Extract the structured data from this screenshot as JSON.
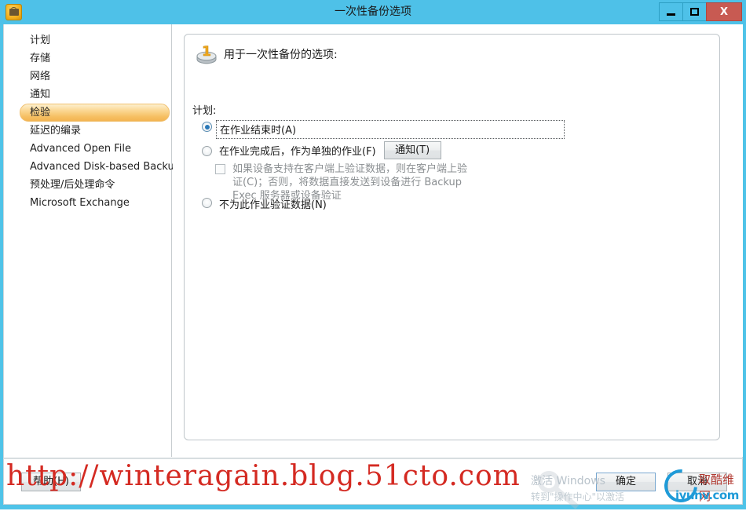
{
  "window": {
    "title": "一次性备份选项",
    "icon": "backup-disk-icon",
    "minimize_label": "",
    "maximize_label": "",
    "close_label": "X",
    "titlebar_color": "#4ec1e8",
    "close_color": "#c85a52"
  },
  "sidebar": {
    "items": [
      {
        "label": "计划",
        "selected": false
      },
      {
        "label": "存储",
        "selected": false
      },
      {
        "label": "网络",
        "selected": false
      },
      {
        "label": "通知",
        "selected": false
      },
      {
        "label": "检验",
        "selected": true
      },
      {
        "label": "延迟的编录",
        "selected": false
      },
      {
        "label": "Advanced Open File",
        "selected": false
      },
      {
        "label": "Advanced Disk-based Backup",
        "selected": false
      },
      {
        "label": "预处理/后处理命令",
        "selected": false
      },
      {
        "label": "Microsoft Exchange",
        "selected": false
      }
    ],
    "selected_color": "#f6bf62"
  },
  "panel": {
    "icon": "one-time-backup-disk-icon",
    "title": "用于一次性备份的选项:",
    "schedule_label": "计划:",
    "options": [
      {
        "id": "at-job-end",
        "label": "在作业结束时(A)",
        "type": "radio",
        "checked": true,
        "focused": true
      },
      {
        "id": "after-job-completes",
        "label": "在作业完成后，作为单独的作业(F)",
        "type": "radio",
        "checked": false,
        "button": "通知(T)"
      },
      {
        "id": "verify-on-client",
        "label": "如果设备支持在客户端上验证数据，则在客户端上验证(C)；否则，将数据直接发送到设备进行 Backup Exec 服务器或设备验证",
        "type": "checkbox",
        "checked": false,
        "disabled": true
      },
      {
        "id": "no-verify",
        "label": "不为此作业验证数据(N)",
        "type": "radio",
        "checked": false
      }
    ]
  },
  "footer": {
    "help_label": "帮助(H)",
    "ok_label": "确定",
    "cancel_label": "取消"
  },
  "watermarks": {
    "url": "http://winteragain.blog.51cto.com",
    "url_color": "#d42a22",
    "activate_line1": "激活 Windows",
    "activate_line2": "转到\"操作中心\"以激活",
    "brand_text": "iyunv.com",
    "brand_cn": "取酷维网"
  }
}
